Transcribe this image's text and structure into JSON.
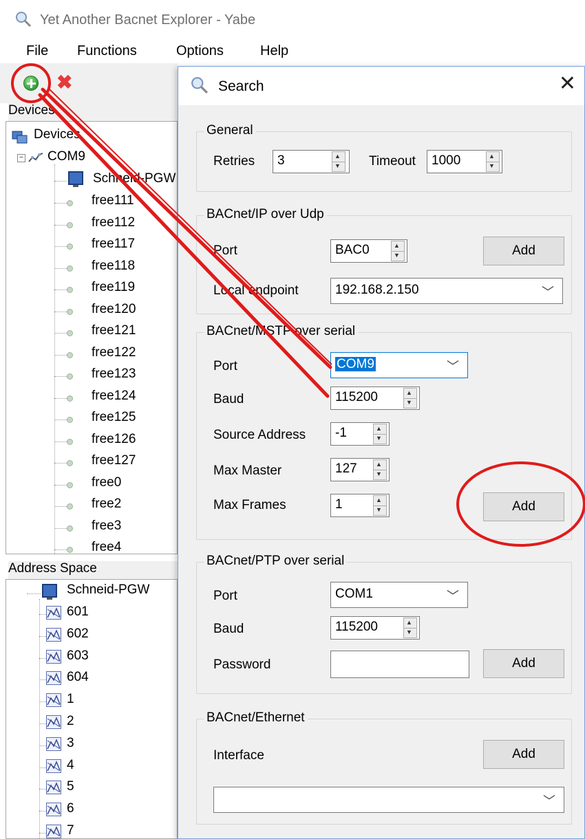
{
  "window": {
    "title": "Yet Another Bacnet Explorer - Yabe"
  },
  "menu": [
    "File",
    "Functions",
    "Options",
    "Help"
  ],
  "toolbar": {
    "add_icon": "add-device-icon",
    "remove_icon": "remove-device-icon"
  },
  "devices_panel": {
    "label": "Devices",
    "root": "Devices",
    "port": "COM9",
    "device": "Schneid-PGW",
    "items": [
      "free111",
      "free112",
      "free117",
      "free118",
      "free119",
      "free120",
      "free121",
      "free122",
      "free123",
      "free124",
      "free125",
      "free126",
      "free127",
      "free0",
      "free2",
      "free3",
      "free4"
    ]
  },
  "address_panel": {
    "label": "Address Space",
    "root": "Schneid-PGW",
    "items": [
      "601",
      "602",
      "603",
      "604",
      "1",
      "2",
      "3",
      "4",
      "5",
      "6",
      "7"
    ]
  },
  "dialog": {
    "title": "Search",
    "close": "✕",
    "general": {
      "title": "General",
      "retries_label": "Retries",
      "retries_value": "3",
      "timeout_label": "Timeout",
      "timeout_value": "1000"
    },
    "ip": {
      "title": "BACnet/IP over Udp",
      "port_label": "Port",
      "port_value": "BAC0",
      "add": "Add",
      "endpoint_label": "Local endpoint",
      "endpoint_value": "192.168.2.150"
    },
    "mstp": {
      "title": "BACnet/MSTP over serial",
      "port_label": "Port",
      "port_value": "COM9",
      "baud_label": "Baud",
      "baud_value": "115200",
      "source_label": "Source Address",
      "source_value": "-1",
      "maxmaster_label": "Max Master",
      "maxmaster_value": "127",
      "maxframes_label": "Max Frames",
      "maxframes_value": "1",
      "add": "Add"
    },
    "ptp": {
      "title": "BACnet/PTP over serial",
      "port_label": "Port",
      "port_value": "COM1",
      "baud_label": "Baud",
      "baud_value": "115200",
      "password_label": "Password",
      "password_value": "",
      "add": "Add"
    },
    "ethernet": {
      "title": "BACnet/Ethernet",
      "interface_label": "Interface",
      "interface_value": "",
      "add": "Add"
    }
  },
  "colors": {
    "annotation": "#e01b1b",
    "accent": "#0078d7"
  }
}
